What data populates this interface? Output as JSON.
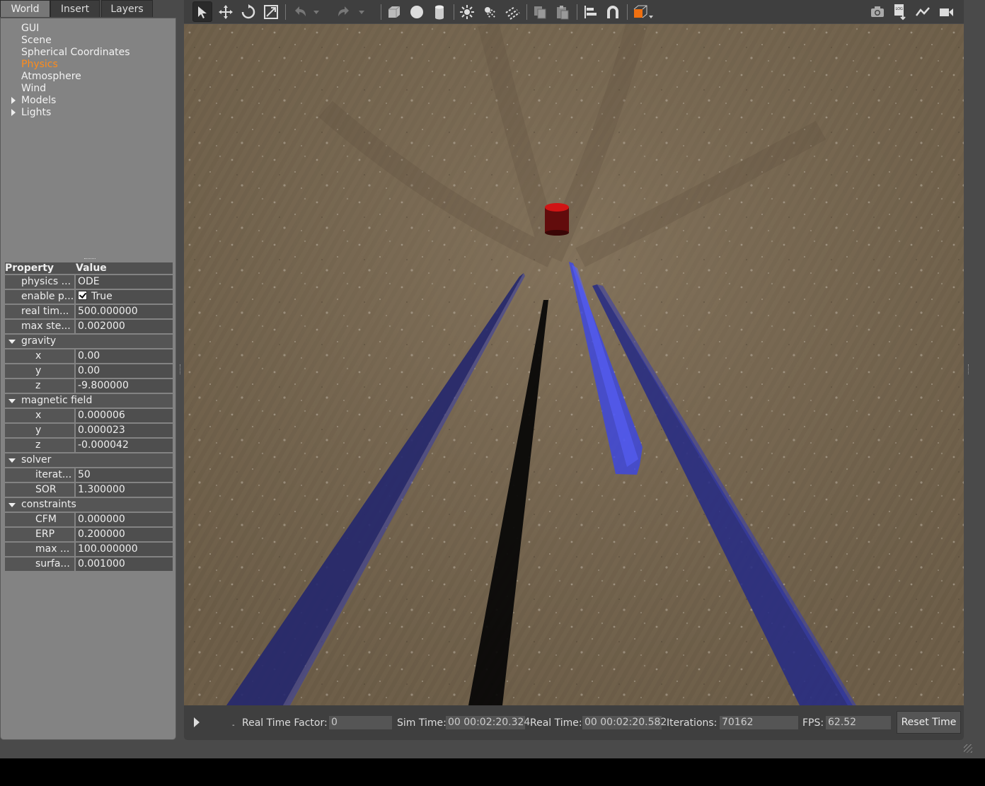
{
  "tabs": [
    {
      "label": "World",
      "active": true
    },
    {
      "label": "Insert",
      "active": false
    },
    {
      "label": "Layers",
      "active": false
    }
  ],
  "tree": [
    {
      "label": "GUI",
      "expandable": false,
      "active": false
    },
    {
      "label": "Scene",
      "expandable": false,
      "active": false
    },
    {
      "label": "Spherical Coordinates",
      "expandable": false,
      "active": false
    },
    {
      "label": "Physics",
      "expandable": false,
      "active": true
    },
    {
      "label": "Atmosphere",
      "expandable": false,
      "active": false
    },
    {
      "label": "Wind",
      "expandable": false,
      "active": false
    },
    {
      "label": "Models",
      "expandable": true,
      "active": false
    },
    {
      "label": "Lights",
      "expandable": true,
      "active": false
    }
  ],
  "properties": {
    "header": {
      "property": "Property",
      "value": "Value"
    },
    "rows": [
      {
        "type": "prop",
        "key": "physics ...",
        "value": "ODE"
      },
      {
        "type": "check",
        "key": "enable p...",
        "value": "True"
      },
      {
        "type": "prop",
        "key": "real tim...",
        "value": "500.000000"
      },
      {
        "type": "prop",
        "key": "max ste...",
        "value": "0.002000"
      },
      {
        "type": "group",
        "key": "gravity"
      },
      {
        "type": "sub",
        "key": "x",
        "value": "0.00"
      },
      {
        "type": "sub",
        "key": "y",
        "value": "0.00"
      },
      {
        "type": "sub",
        "key": "z",
        "value": "-9.800000"
      },
      {
        "type": "group",
        "key": "magnetic field"
      },
      {
        "type": "sub",
        "key": "x",
        "value": "0.000006"
      },
      {
        "type": "sub",
        "key": "y",
        "value": "0.000023"
      },
      {
        "type": "sub",
        "key": "z",
        "value": "-0.000042"
      },
      {
        "type": "group",
        "key": "solver"
      },
      {
        "type": "sub",
        "key": "iterat...",
        "value": "50"
      },
      {
        "type": "sub",
        "key": "SOR",
        "value": "1.300000"
      },
      {
        "type": "group",
        "key": "constraints"
      },
      {
        "type": "sub",
        "key": "CFM",
        "value": "0.000000"
      },
      {
        "type": "sub",
        "key": "ERP",
        "value": "0.200000"
      },
      {
        "type": "sub",
        "key": "max ...",
        "value": "100.000000"
      },
      {
        "type": "sub",
        "key": "surfa...",
        "value": "0.001000"
      }
    ]
  },
  "toolbar": {
    "left_icons": [
      "select-arrow-icon",
      "translate-icon",
      "rotate-icon",
      "scale-icon",
      "undo-icon",
      "undo-dropdown-icon",
      "redo-icon",
      "redo-dropdown-icon",
      "box-shape-icon",
      "sphere-shape-icon",
      "cylinder-shape-icon",
      "point-light-icon",
      "spot-light-icon",
      "directional-light-icon",
      "copy-icon",
      "paste-icon",
      "align-icon",
      "snap-icon",
      "view-angle-icon"
    ],
    "right_icons": [
      "screenshot-icon",
      "log-icon",
      "plot-icon",
      "record-video-icon"
    ]
  },
  "status": {
    "real_time_factor_label": "Real Time Factor:",
    "real_time_factor": "0",
    "sim_time_label": "Sim Time:",
    "sim_time": "00 00:02:20.324",
    "real_time_label": "Real Time:",
    "real_time": "00 00:02:20.582",
    "iterations_label": "Iterations:",
    "iterations": "70162",
    "fps_label": "FPS:",
    "fps": "62.52",
    "reset_label": "Reset Time"
  },
  "colors": {
    "accent": "#ff8c1a",
    "panel": "#838383",
    "toolbar": "#3f3f3f",
    "ground": "#76664f",
    "laser_blue": "#2b2f8f",
    "laser_bright": "#3d46e6",
    "target_red": "#c01010"
  }
}
